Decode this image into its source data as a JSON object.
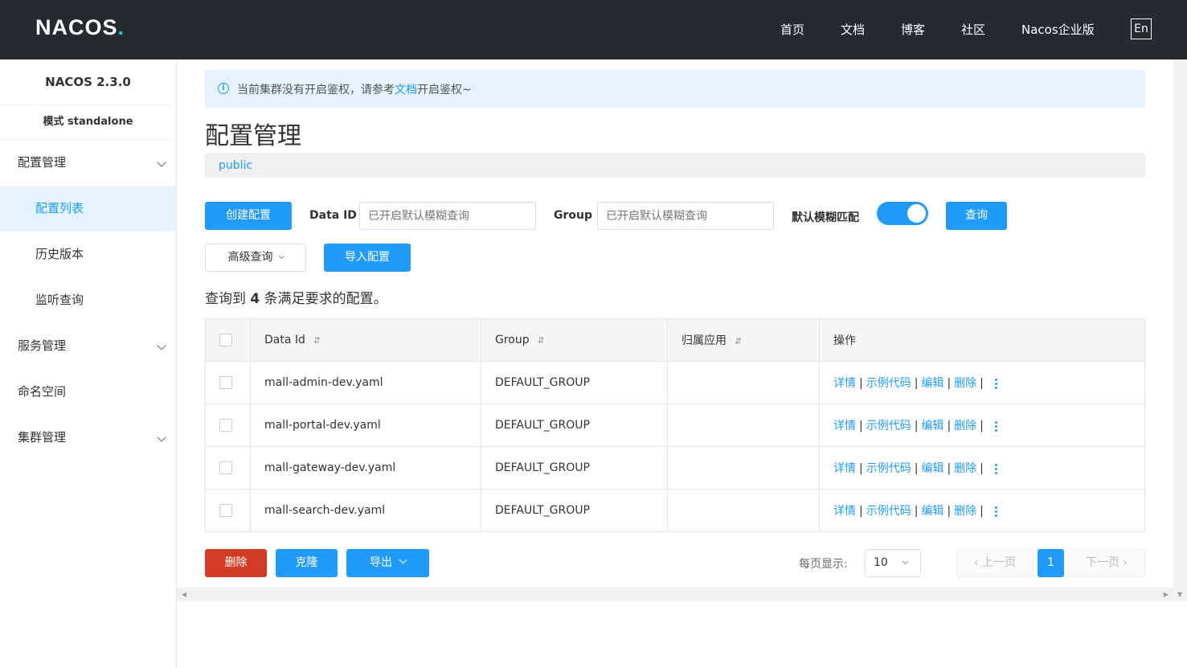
{
  "topbar": {
    "logo": "NACOS",
    "logo_dot": ".",
    "nav": [
      "首页",
      "文档",
      "博客",
      "社区",
      "Nacos企业版"
    ],
    "lang_button": "En"
  },
  "sidebar": {
    "version": "NACOS 2.3.0",
    "mode": "模式 standalone",
    "items": [
      {
        "label": "配置管理"
      },
      {
        "label": "配置列表"
      },
      {
        "label": "历史版本"
      },
      {
        "label": "监听查询"
      },
      {
        "label": "服务管理"
      },
      {
        "label": "命名空间"
      },
      {
        "label": "集群管理"
      }
    ]
  },
  "alert": {
    "prefix": "当前集群没有开启鉴权，请参考",
    "link": "文档",
    "suffix": "开启鉴权~"
  },
  "page_title": "配置管理",
  "namespace": "public",
  "toolbar": {
    "create_label": "创建配置",
    "data_id_label": "Data ID",
    "data_id_placeholder": "已开启默认模糊查询",
    "group_label": "Group",
    "group_placeholder": "已开启默认模糊查询",
    "fuzzy_label": "默认模糊匹配",
    "query_label": "查询",
    "advanced_label": "高级查询",
    "import_label": "导入配置"
  },
  "result": {
    "prefix": "查询到",
    "count": "4",
    "suffix": "条满足要求的配置。"
  },
  "table": {
    "headers": {
      "data_id": "Data Id",
      "group": "Group",
      "app": "归属应用",
      "ops": "操作"
    },
    "ops": {
      "detail": "详情",
      "sample": "示例代码",
      "edit": "编辑",
      "delete": "删除"
    },
    "rows": [
      {
        "data_id": "mall-admin-dev.yaml",
        "group": "DEFAULT_GROUP",
        "app": ""
      },
      {
        "data_id": "mall-portal-dev.yaml",
        "group": "DEFAULT_GROUP",
        "app": ""
      },
      {
        "data_id": "mall-gateway-dev.yaml",
        "group": "DEFAULT_GROUP",
        "app": ""
      },
      {
        "data_id": "mall-search-dev.yaml",
        "group": "DEFAULT_GROUP",
        "app": ""
      }
    ]
  },
  "footer": {
    "delete_label": "删除",
    "clone_label": "克隆",
    "export_label": "导出",
    "per_page_label": "每页显示:",
    "per_page_value": "10",
    "prev_label": "上一页",
    "current_page": "1",
    "next_label": "下一页"
  },
  "colors": {
    "primary": "#209bfa",
    "danger": "#d23c26",
    "topbar": "#252a2f"
  }
}
